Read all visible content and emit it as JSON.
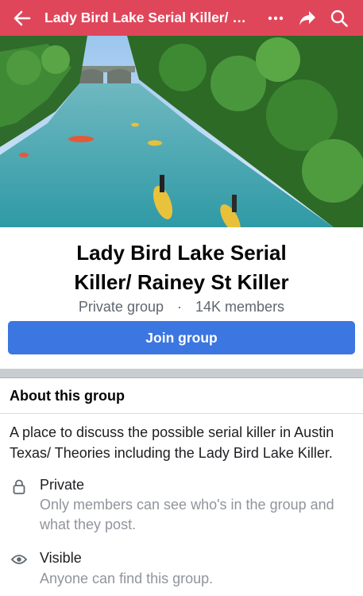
{
  "header": {
    "title": "Lady Bird Lake Serial Killer/ Rainey St Killer",
    "back_icon": "arrow-left-icon",
    "more_icon": "more-dots-icon",
    "share_icon": "share-icon",
    "search_icon": "search-icon",
    "color": "#e0465a"
  },
  "group": {
    "name_line1": "Lady Bird Lake Serial",
    "name_line2": "Killer/ Rainey St Killer",
    "privacy": "Private group",
    "separator": "·",
    "members": "14K members",
    "join_label": "Join group",
    "join_color": "#3b76e1"
  },
  "about": {
    "heading": "About this group",
    "description": "A place to discuss the possible serial killer in Austin Texas/ Theories including the Lady Bird Lake Killer.",
    "items": [
      {
        "icon": "lock-icon",
        "title": "Private",
        "subtitle": "Only members can see who's in the group and what they post."
      },
      {
        "icon": "eye-icon",
        "title": "Visible",
        "subtitle": "Anyone can find this group."
      }
    ]
  }
}
